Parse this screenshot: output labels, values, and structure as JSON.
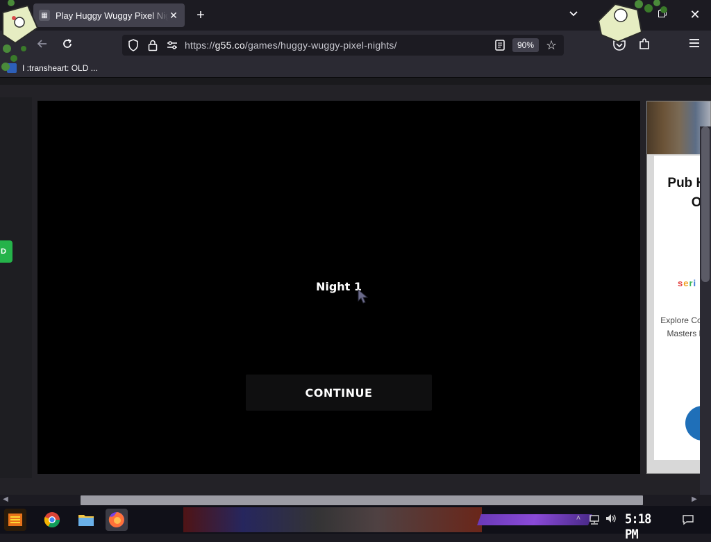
{
  "browser": {
    "tab": {
      "title": "Play Huggy Wuggy Pixel Nights",
      "close": "✕"
    },
    "new_tab": "+",
    "tablist": "⌄",
    "window_close": "✕",
    "url_host": "g55.co",
    "url_path": "/games/huggy-wuggy-pixel-nights/",
    "url_scheme": "https://",
    "zoom": "90%",
    "bookmark": "I :transheart: OLD ..."
  },
  "game": {
    "night_label": "Night 1",
    "continue_label": "CONTINUE"
  },
  "ad": {
    "headline": "Pub Hea Deg Optic",
    "brand": "seri",
    "body": "Explore Compare Public H Masters D for Y Aspirat"
  },
  "left_panel": {
    "play_partial": "D"
  },
  "taskbar": {
    "clock": "5:18 PM"
  },
  "colors": {
    "chrome_bg": "#1c1b22",
    "toolbar_bg": "#2b2a33",
    "game_bg": "#000000",
    "continue_bg": "#0f0f10",
    "accent_green": "#25b34a",
    "ad_arrow": "#1f6fb8"
  },
  "icons": [
    "back-icon",
    "reload-icon",
    "shield-icon",
    "lock-icon",
    "permissions-icon",
    "reader-view-icon",
    "star-icon",
    "pocket-icon",
    "extensions-icon",
    "menu-icon",
    "start-icon",
    "chrome-icon",
    "files-icon",
    "firefox-icon",
    "network-icon",
    "volume-icon",
    "notification-icon",
    "cursor-icon"
  ]
}
